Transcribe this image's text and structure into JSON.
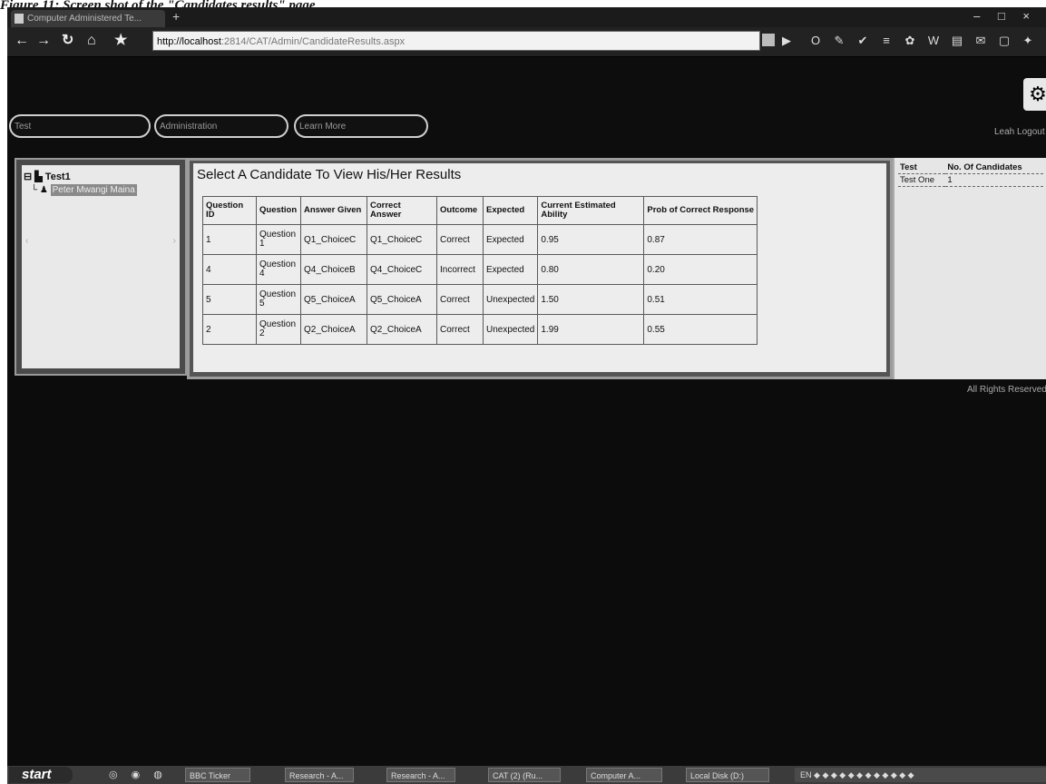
{
  "caption": "Figure 11: Screen shot of the \"Candidates results\" page",
  "browser": {
    "tab_title": "Computer Administered Te...",
    "new_tab": "+",
    "window_controls": "– □ ×",
    "address_host": "http://localhost",
    "address_rest": ":2814/CAT/Admin/CandidateResults.aspx",
    "nav_icons": [
      "back-arrow-icon",
      "forward-arrow-icon",
      "reload-icon",
      "home-icon",
      "star-icon"
    ]
  },
  "app": {
    "nav_pills": [
      "Test",
      "Administration",
      "Learn More"
    ],
    "auth_links": "Leah  Logout"
  },
  "tree": {
    "root_label": "Test1",
    "child_label": "Peter Mwangi Maina"
  },
  "main": {
    "title": "Select A Candidate To View His/Her Results",
    "columns": [
      "Question ID",
      "Question",
      "Answer Given",
      "Correct Answer",
      "Outcome",
      "Expected",
      "Current Estimated Ability",
      "Prob of Correct Response"
    ],
    "rows": [
      [
        "1",
        "Question 1",
        "Q1_ChoiceC",
        "Q1_ChoiceC",
        "Correct",
        "Expected",
        "0.95",
        "0.87"
      ],
      [
        "4",
        "Question 4",
        "Q4_ChoiceB",
        "Q4_ChoiceC",
        "Incorrect",
        "Expected",
        "0.80",
        "0.20"
      ],
      [
        "5",
        "Question 5",
        "Q5_ChoiceA",
        "Q5_ChoiceA",
        "Correct",
        "Unexpected",
        "1.50",
        "0.51"
      ],
      [
        "2",
        "Question 2",
        "Q2_ChoiceA",
        "Q2_ChoiceA",
        "Correct",
        "Unexpected",
        "1.99",
        "0.55"
      ]
    ]
  },
  "stats": {
    "columns": [
      "Test",
      "No. Of Candidates"
    ],
    "rows": [
      [
        "Test One",
        "1"
      ]
    ]
  },
  "footer": "All Rights Reserved",
  "taskbar": {
    "start_label": "start",
    "items": [
      "BBC Ticker",
      "Research - A...",
      "Research - A...",
      "CAT (2) (Ru...",
      "Computer A...",
      "Local Disk (D:)"
    ],
    "tray_lang": "EN"
  }
}
